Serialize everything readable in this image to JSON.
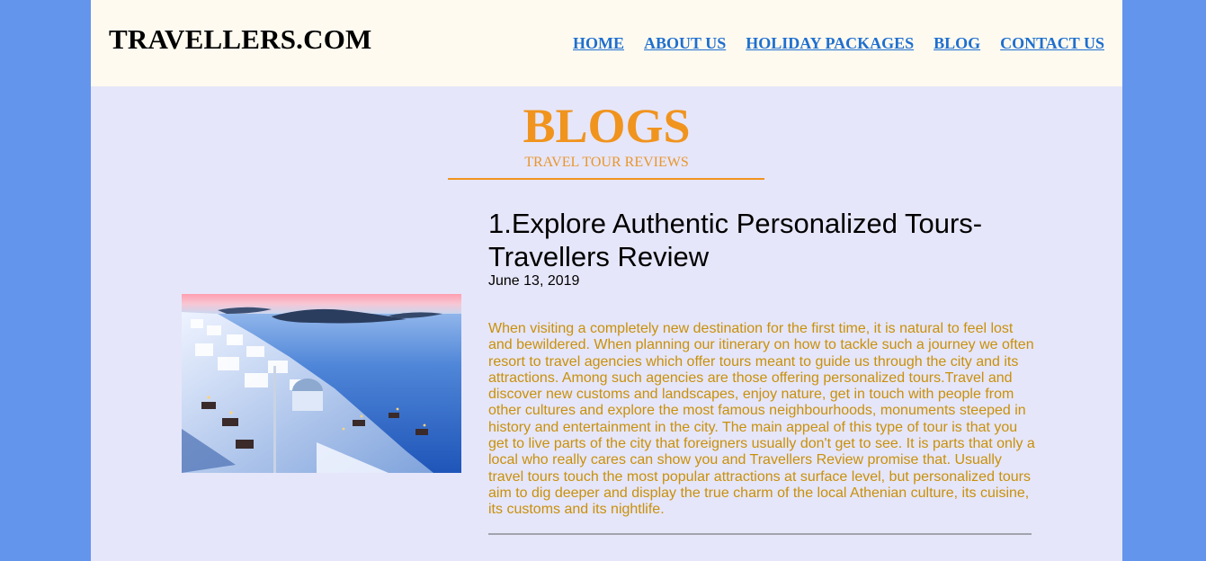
{
  "site": {
    "logo": "TRAVELLERS.COM"
  },
  "nav": {
    "items": [
      {
        "label": "HOME"
      },
      {
        "label": "ABOUT US"
      },
      {
        "label": "HOLIDAY PACKAGES"
      },
      {
        "label": "BLOG"
      },
      {
        "label": "CONTACT US"
      }
    ]
  },
  "section": {
    "title": "BLOGS",
    "subtitle": "TRAVEL TOUR REVIEWS"
  },
  "post": {
    "title": "1.Explore Authentic Personalized Tours-Travellers Review",
    "date": "June 13, 2019",
    "body": "When visiting a completely new destination for the first time, it is natural to feel lost and bewildered. When planning our itinerary on how to tackle such a journey we often resort to travel agencies which offer tours meant to guide us through the city and its attractions. Among such agencies are those offering personalized tours.Travel and discover new customs and landscapes, enjoy nature, get in touch with people from other cultures and explore the most famous neighbourhoods, monuments steeped in history and entertainment in the city. The main appeal of this type of tour is that you get to live parts of the city that foreigners usually don't get to see. It is parts that only a local who really cares can show you and Travellers Review promise that. Usually travel tours touch the most popular attractions at surface level, but personalized tours aim to dig deeper and display the true charm of the local Athenian culture, its cuisine, its customs and its nightlife."
  },
  "colors": {
    "page_background": "#6495ed",
    "content_background": "#e6e6fa",
    "header_background": "#fffaf0",
    "accent_orange": "#f0941e",
    "link_blue": "#1e6fcf",
    "body_text": "#c8900a"
  }
}
